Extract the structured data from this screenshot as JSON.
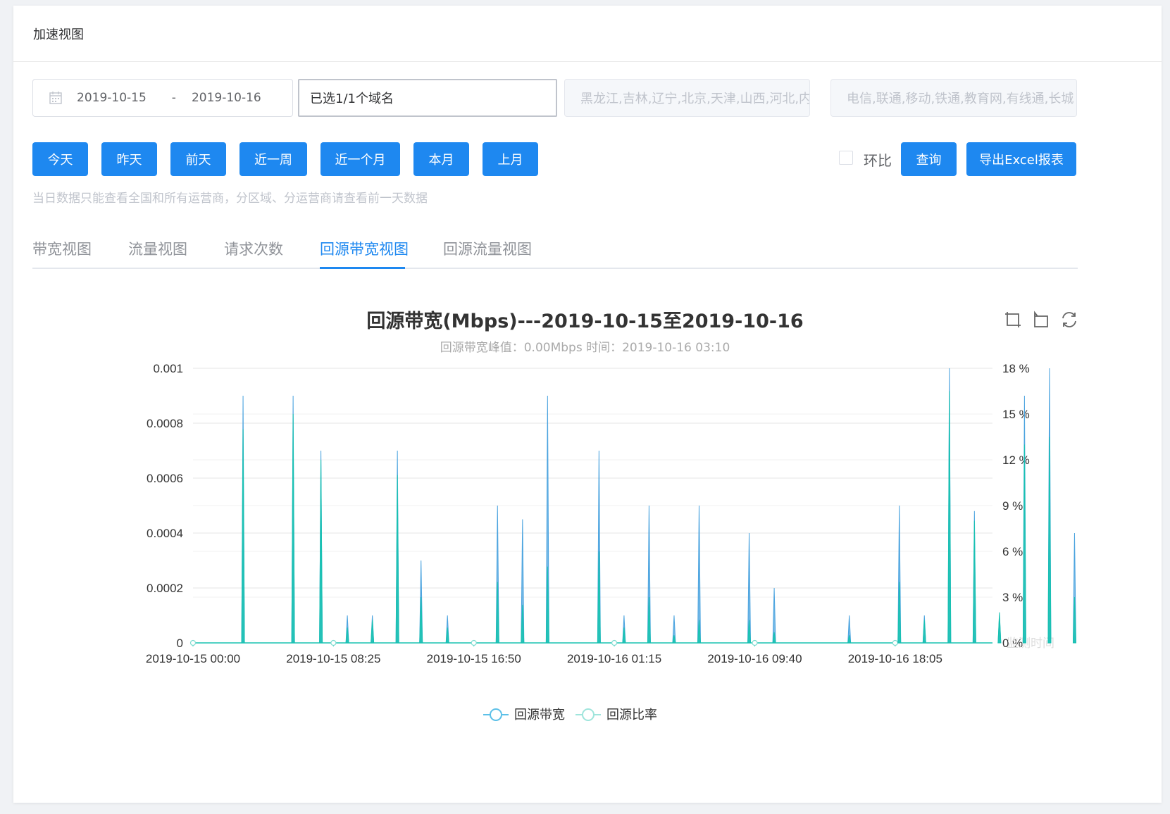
{
  "card": {
    "title": "加速视图"
  },
  "filters": {
    "date_start": "2019-10-15",
    "date_sep": "-",
    "date_end": "2019-10-16",
    "domain": "已选1/1个域名",
    "region_placeholder": "黑龙江,吉林,辽宁,北京,天津,山西,河北,内",
    "isp_placeholder": "电信,联通,移动,铁通,教育网,有线通,长城"
  },
  "quick_buttons": [
    "今天",
    "昨天",
    "前天",
    "近一周",
    "近一个月",
    "本月",
    "上月"
  ],
  "compare_label": "环比",
  "query_label": "查询",
  "export_label": "导出Excel报表",
  "hint": "当日数据只能查看全国和所有运营商，分区域、分运营商请查看前一天数据",
  "tabs": [
    "带宽视图",
    "流量视图",
    "请求次数",
    "回源带宽视图",
    "回源流量视图"
  ],
  "active_tab": 3,
  "colors": {
    "primary": "#1e88f0",
    "series_bandwidth": "#4aa3df",
    "series_ratio": "#17c2b0"
  },
  "icons": [
    "zoom-area-icon",
    "zoom-reset-icon",
    "restore-icon"
  ],
  "chart_data": {
    "type": "line",
    "title": "回源带宽(Mbps)---2019-10-15至2019-10-16",
    "subtitle": "回源带宽峰值：0.00Mbps 时间：2019-10-16 03:10",
    "x_labels": [
      "2019-10-15 00:00",
      "2019-10-15 08:25",
      "2019-10-15 16:50",
      "2019-10-16 01:15",
      "2019-10-16 09:40",
      "2019-10-16 18:05"
    ],
    "x_start": "2019-10-15 00:00",
    "x_end": "2019-10-16 23:55",
    "x_step_minutes": 5,
    "x_axis_name": "监测时间",
    "y_left": {
      "min": 0,
      "max": 0.001,
      "ticks": [
        "0",
        "0.0002",
        "0.0004",
        "0.0006",
        "0.0008",
        "0.001"
      ]
    },
    "y_right": {
      "min": 0,
      "max": 18,
      "ticks": [
        "0 %",
        "3 %",
        "6 %",
        "9 %",
        "12 %",
        "15 %",
        "18 %"
      ]
    },
    "grid": true,
    "legend_position": "bottom-center",
    "series": [
      {
        "name": "回源带宽",
        "axis": "left",
        "spikes": [
          [
            "2019-10-15 03:00",
            0.0009
          ],
          [
            "2019-10-15 06:00",
            0.0009
          ],
          [
            "2019-10-15 07:40",
            0.0007
          ],
          [
            "2019-10-15 09:15",
            0.0001
          ],
          [
            "2019-10-15 10:45",
            0.0001
          ],
          [
            "2019-10-15 12:15",
            0.0007
          ],
          [
            "2019-10-15 13:40",
            0.0003
          ],
          [
            "2019-10-15 15:15",
            0.0001
          ],
          [
            "2019-10-15 18:15",
            0.0005
          ],
          [
            "2019-10-15 19:45",
            0.00045
          ],
          [
            "2019-10-15 21:15",
            0.0009
          ],
          [
            "2019-10-16 00:20",
            0.0007
          ],
          [
            "2019-10-16 01:50",
            0.0001
          ],
          [
            "2019-10-16 03:20",
            0.0005
          ],
          [
            "2019-10-16 04:50",
            0.0001
          ],
          [
            "2019-10-16 06:20",
            0.0005
          ],
          [
            "2019-10-16 09:20",
            0.0004
          ],
          [
            "2019-10-16 10:50",
            0.0002
          ],
          [
            "2019-10-16 15:20",
            0.0001
          ],
          [
            "2019-10-16 18:20",
            0.0005
          ],
          [
            "2019-10-16 19:50",
            0.0001
          ],
          [
            "2019-10-16 21:20",
            0.001
          ],
          [
            "2019-10-16 22:50",
            0.00048
          ],
          [
            "2019-10-17 00:20",
            0.0001
          ],
          [
            "2019-10-17 01:50",
            0.0009
          ],
          [
            "2019-10-17 03:20",
            0.001
          ],
          [
            "2019-10-17 04:50",
            0.0004
          ]
        ]
      },
      {
        "name": "回源比率",
        "axis": "right",
        "spikes": [
          [
            "2019-10-15 03:00",
            14
          ],
          [
            "2019-10-15 06:00",
            15
          ],
          [
            "2019-10-15 07:40",
            12
          ],
          [
            "2019-10-15 09:15",
            1
          ],
          [
            "2019-10-15 10:45",
            1.5
          ],
          [
            "2019-10-15 12:15",
            11
          ],
          [
            "2019-10-15 13:40",
            3
          ],
          [
            "2019-10-15 15:15",
            1
          ],
          [
            "2019-10-15 18:15",
            4
          ],
          [
            "2019-10-15 19:45",
            2.5
          ],
          [
            "2019-10-15 21:15",
            5
          ],
          [
            "2019-10-16 00:20",
            6
          ],
          [
            "2019-10-16 01:50",
            1
          ],
          [
            "2019-10-16 03:20",
            3
          ],
          [
            "2019-10-16 04:50",
            0.5
          ],
          [
            "2019-10-16 06:20",
            1.5
          ],
          [
            "2019-10-16 09:20",
            1.5
          ],
          [
            "2019-10-16 10:50",
            0.7
          ],
          [
            "2019-10-16 15:20",
            0.5
          ],
          [
            "2019-10-16 18:20",
            4
          ],
          [
            "2019-10-16 19:50",
            1.5
          ],
          [
            "2019-10-16 21:20",
            16.5
          ],
          [
            "2019-10-16 22:50",
            8
          ],
          [
            "2019-10-17 00:20",
            2
          ],
          [
            "2019-10-17 01:50",
            13
          ],
          [
            "2019-10-17 03:20",
            13.5
          ],
          [
            "2019-10-17 04:50",
            3
          ]
        ]
      }
    ]
  }
}
